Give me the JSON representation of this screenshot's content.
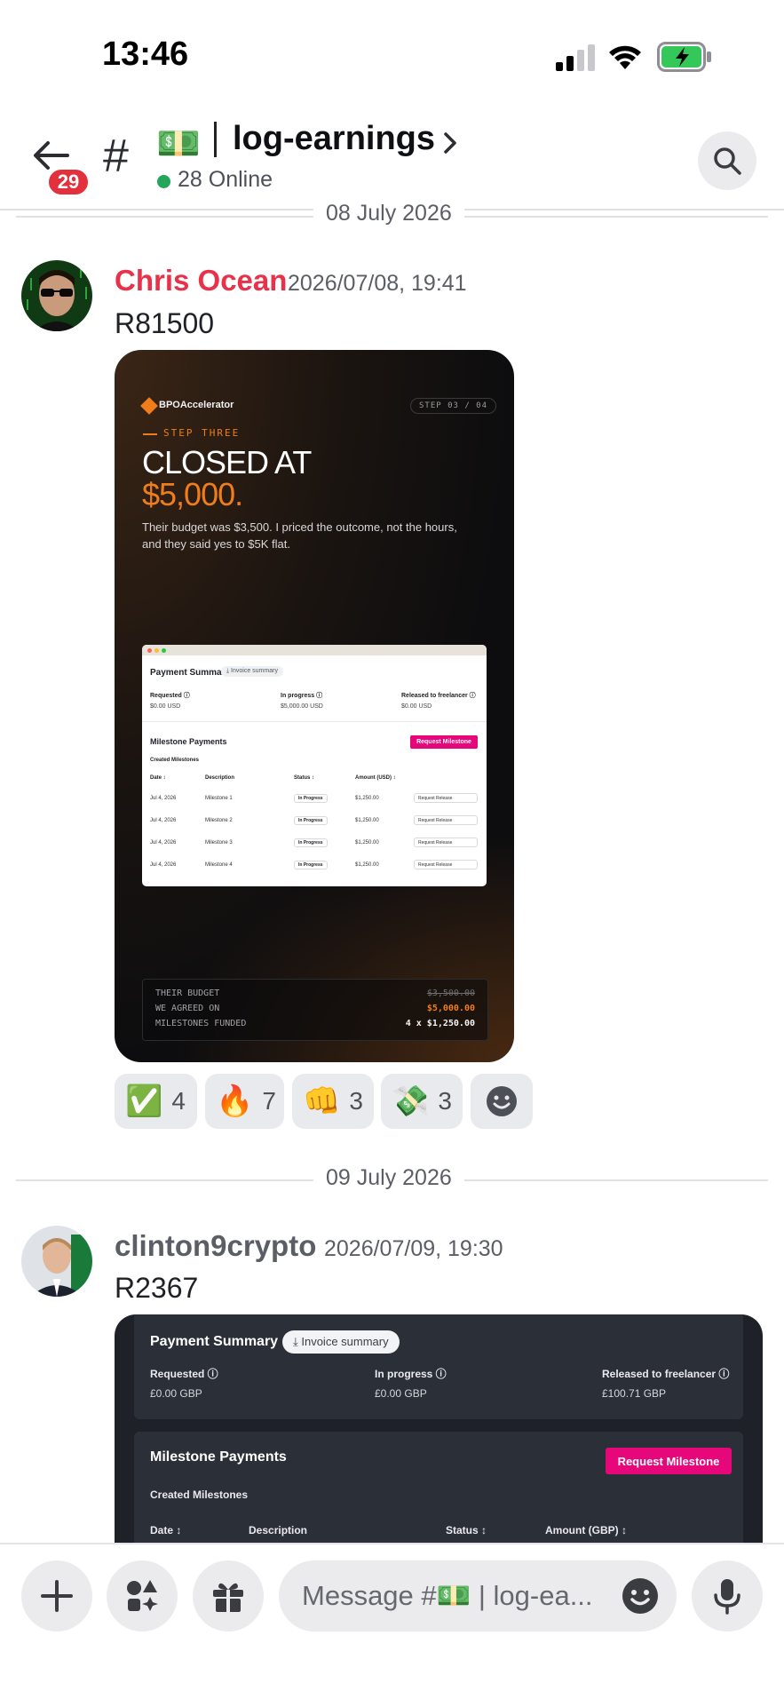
{
  "status_bar": {
    "time": "13:46"
  },
  "header": {
    "unread_badge": "29",
    "hash": "#",
    "channel_emoji": "💵",
    "channel_name": "log-earnings",
    "online_text": "28 Online"
  },
  "dividers": [
    "08 July 2026",
    "09 July 2026"
  ],
  "messages": [
    {
      "author": "Chris Ocean",
      "author_color": "#e8324a",
      "timestamp": "2026/07/08, 19:41",
      "text": "R81500",
      "card": {
        "logo": "BPOAccelerator",
        "step_pill": "STEP 03 / 04",
        "step_label": "STEP THREE",
        "headline": "CLOSED AT",
        "amount": "$5,000.",
        "description": "Their budget was $3,500. I priced the outcome, not the hours, and they said yes to $5K flat.",
        "screenshot": {
          "title": "Payment Summary",
          "pill": "⤓ Invoice summary",
          "cols": [
            {
              "label": "Requested ⓘ",
              "value": "$0.00 USD"
            },
            {
              "label": "In progress ⓘ",
              "value": "$5,000.00 USD"
            },
            {
              "label": "Released to freelancer ⓘ",
              "value": "$0.00 USD"
            }
          ],
          "milestones_title": "Milestone Payments",
          "request_btn": "Request Milestone",
          "created": "Created Milestones",
          "headers": [
            "Date ↕",
            "Description",
            "Status ↕",
            "Amount (USD) ↕"
          ],
          "rows": [
            {
              "date": "Jul 4, 2026",
              "desc": "Milestone 1",
              "status": "In Progress",
              "amount": "$1,250.00",
              "action": "Request Release"
            },
            {
              "date": "Jul 4, 2026",
              "desc": "Milestone 2",
              "status": "In Progress",
              "amount": "$1,250.00",
              "action": "Request Release"
            },
            {
              "date": "Jul 4, 2026",
              "desc": "Milestone 3",
              "status": "In Progress",
              "amount": "$1,250.00",
              "action": "Request Release"
            },
            {
              "date": "Jul 4, 2026",
              "desc": "Milestone 4",
              "status": "In Progress",
              "amount": "$1,250.00",
              "action": "Request Release"
            }
          ]
        },
        "footer": [
          {
            "label": "THEIR BUDGET",
            "value": "$3,500.00"
          },
          {
            "label": "WE AGREED ON",
            "value": "$5,000.00"
          },
          {
            "label": "MILESTONES FUNDED",
            "value": "4 x $1,250.00"
          }
        ]
      },
      "reactions": [
        {
          "emoji": "✅",
          "count": "4"
        },
        {
          "emoji": "🔥",
          "count": "7"
        },
        {
          "emoji": "👊",
          "count": "3"
        },
        {
          "emoji": "💸",
          "count": "3"
        }
      ]
    },
    {
      "author": "clinton9crypto",
      "author_color": "#5c5e66",
      "timestamp": "2026/07/09, 19:30",
      "text": "R2367",
      "card": {
        "title": "Payment Summary",
        "pill": "⤓ Invoice summary",
        "cols": [
          {
            "label": "Requested ⓘ",
            "value": "£0.00 GBP"
          },
          {
            "label": "In progress ⓘ",
            "value": "£0.00 GBP"
          },
          {
            "label": "Released to freelancer ⓘ",
            "value": "£100.71 GBP"
          }
        ],
        "milestones_title": "Milestone Payments",
        "request_btn": "Request Milestone",
        "created": "Created Milestones",
        "headers": [
          "Date ↕",
          "Description",
          "Status ↕",
          "Amount (GBP) ↕"
        ]
      }
    }
  ],
  "composer": {
    "placeholder": "Message #💵 | log-ea..."
  },
  "colors": {
    "accent_pink": "#e6077a",
    "orange": "#f07d1b",
    "online": "#23a55a",
    "badge_red": "#e2303d"
  }
}
